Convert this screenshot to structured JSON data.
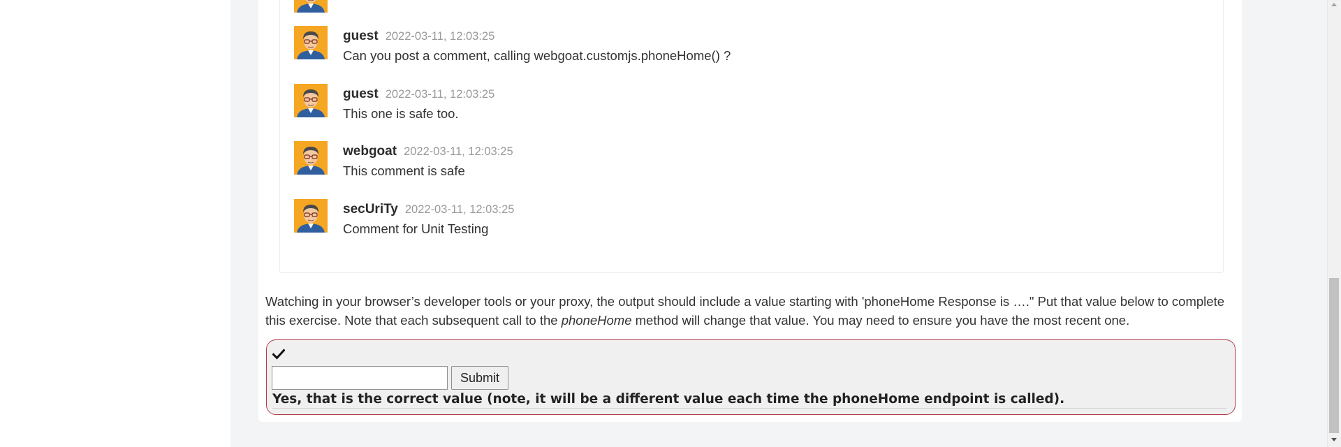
{
  "comments": [
    {
      "user": "",
      "time": "",
      "text": ""
    },
    {
      "user": "guest",
      "time": "2022-03-11, 12:03:25",
      "text": "Can you post a comment, calling webgoat.customjs.phoneHome() ?"
    },
    {
      "user": "guest",
      "time": "2022-03-11, 12:03:25",
      "text": "This one is safe too."
    },
    {
      "user": "webgoat",
      "time": "2022-03-11, 12:03:25",
      "text": "This comment is safe"
    },
    {
      "user": "secUriTy",
      "time": "2022-03-11, 12:03:25",
      "text": "Comment for Unit Testing"
    }
  ],
  "instructions": {
    "part1": "Watching in your browser’s developer tools or your proxy, the output should include a value starting with 'phoneHome Response is ….\" Put that value below to complete this exercise. Note that each subsequent call to the ",
    "method": "phoneHome",
    "part2": " method will change that value. You may need to ensure you have the most recent one."
  },
  "form": {
    "input_value": "",
    "input_placeholder": "",
    "submit_label": "Submit",
    "success_icon": "check-icon",
    "feedback": "Yes, that is the correct value (note, it will be a different value each time the phoneHome endpoint is called)."
  },
  "colors": {
    "avatar_bg": "#f5a623",
    "attack_border": "#b0404a",
    "attack_bg": "#f0f0f0",
    "timestamp": "#9a9a9a"
  }
}
